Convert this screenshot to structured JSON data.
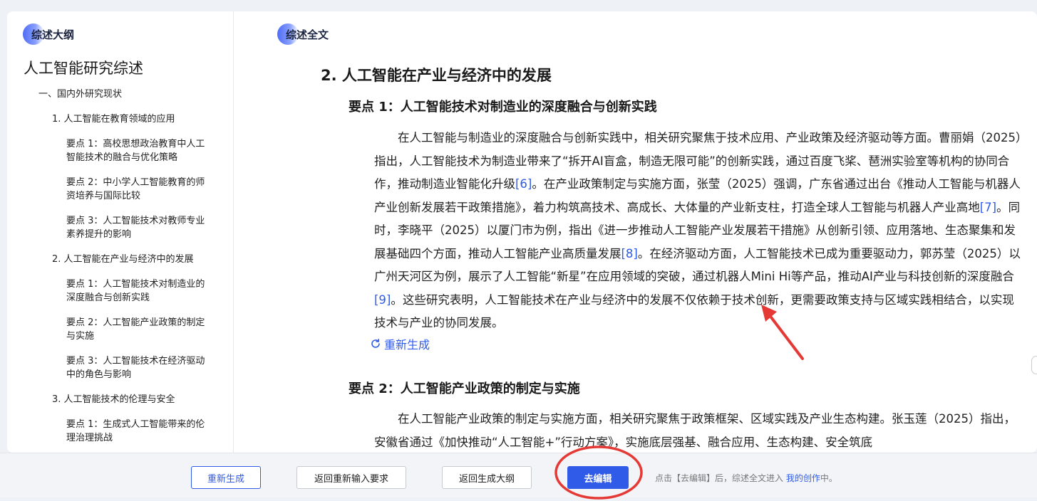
{
  "sidebar": {
    "pill_label": "综述大纲",
    "title": "人工智能研究综述",
    "items": [
      {
        "label": "一、国内外研究现状"
      },
      {
        "label": "1. 人工智能在教育领域的应用"
      },
      {
        "label": "要点 1：高校思想政治教育中人工智能技术的融合与优化策略"
      },
      {
        "label": "要点 2：中小学人工智能教育的师资培养与国际比较"
      },
      {
        "label": "要点 3：人工智能技术对教师专业素养提升的影响"
      },
      {
        "label": "2. 人工智能在产业与经济中的发展"
      },
      {
        "label": "要点 1：人工智能技术对制造业的深度融合与创新实践"
      },
      {
        "label": "要点 2：人工智能产业政策的制定与实施"
      },
      {
        "label": "要点 3：人工智能技术在经济驱动中的角色与影响"
      },
      {
        "label": "3. 人工智能技术的伦理与安全"
      },
      {
        "label": "要点 1：生成式人工智能带来的伦理治理挑战"
      }
    ]
  },
  "main": {
    "pill_label": "综述全文",
    "section_title": "2. 人工智能在产业与经济中的发展",
    "point1_title": "要点 1：人工智能技术对制造业的深度融合与创新实践",
    "point1_body": [
      {
        "text": "在人工智能与制造业的深度融合与创新实践中，相关研究聚焦于技术应用、产业政策及经济驱动等方面。曹丽娟（2025）指出，人工智能技术为制造业带来了“拆开AI盲盒，制造无限可能”的创新实践，通过百度飞桨、琶洲实验室等机构的协同合作，推动制造业智能化升级"
      },
      {
        "cite": "[6]"
      },
      {
        "text": "。在产业政策制定与实施方面，张莹（2025）强调，广东省通过出台《推动人工智能与机器人产业创新发展若干政策措施》，着力构筑高技术、高成长、大体量的产业新支柱，打造全球人工智能与机器人产业高地"
      },
      {
        "cite": "[7]"
      },
      {
        "text": "。同时，李晓平（2025）以厦门市为例，指出《进一步推动人工智能产业发展若干措施》从创新引领、应用落地、生态聚集和发展基础四个方面，推动人工智能产业高质量发展"
      },
      {
        "cite": "[8]"
      },
      {
        "text": "。在经济驱动方面，人工智能技术已成为重要驱动力，郭苏莹（2025）以广州天河区为例，展示了人工智能“新星”在应用领域的突破，通过机器人Mini Hi等产品，推动AI产业与科技创新的深度融合"
      },
      {
        "cite": "[9]"
      },
      {
        "text": "。这些研究表明，人工智能技术在产业与经济中的发展不仅依赖于技术创新，更需要政策支持与区域实践相结合，以实现技术与产业的协同发展。"
      }
    ],
    "regenerate_link": "重新生成",
    "point2_title": "要点 2：人工智能产业政策的制定与实施",
    "point2_body": "在人工智能产业政策的制定与实施方面，相关研究聚焦于政策框架、区域实践及产业生态构建。张玉莲（2025）指出，安徽省通过《加快推动“人工智能+”行动方案》，实施底层强基、融合应用、生态构建、安全筑底"
  },
  "footer": {
    "regenerate": "重新生成",
    "back_requirements": "返回重新输入要求",
    "back_outline": "返回生成大纲",
    "edit": "去编辑",
    "hint_prefix": "点击【去编辑】后，综述全文进入 ",
    "hint_link": "我的创作",
    "hint_suffix": "中。"
  },
  "colors": {
    "accent": "#2f5be8",
    "annotation": "#e53935"
  },
  "icons": {
    "regenerate": "refresh-icon"
  }
}
